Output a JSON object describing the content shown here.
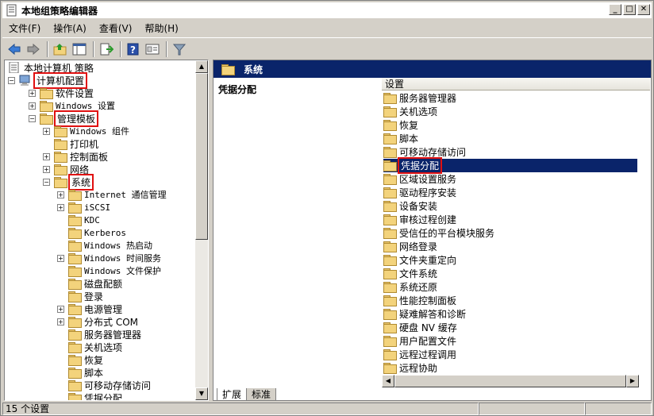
{
  "window": {
    "title": "本地组策略编辑器"
  },
  "caption_buttons": {
    "min": "_",
    "max": "□",
    "close": "✕"
  },
  "menu": [
    {
      "label": "文件(F)"
    },
    {
      "label": "操作(A)"
    },
    {
      "label": "查看(V)"
    },
    {
      "label": "帮助(H)"
    }
  ],
  "toolbar": {
    "icons": [
      "back-arrow-icon",
      "forward-arrow-icon",
      "up-folder-icon",
      "show-hide-tree-icon",
      "export-list-icon",
      "help-icon",
      "properties-icon",
      "filter-icon"
    ]
  },
  "tree": {
    "items": [
      {
        "label": "本地计算机 策略",
        "level": 0,
        "expander": "",
        "icon": "policy"
      },
      {
        "label": "计算机配置",
        "level": 0,
        "expander": "−",
        "icon": "computer"
      },
      {
        "label": "软件设置",
        "level": 1,
        "expander": "+",
        "icon": "folder"
      },
      {
        "label": "Windows 设置",
        "level": 1,
        "expander": "+",
        "icon": "folder"
      },
      {
        "label": "管理模板",
        "level": 1,
        "expander": "−",
        "icon": "folder"
      },
      {
        "label": "Windows 组件",
        "level": 2,
        "expander": "+",
        "icon": "folder"
      },
      {
        "label": "打印机",
        "level": 2,
        "expander": "",
        "icon": "folder"
      },
      {
        "label": "控制面板",
        "level": 2,
        "expander": "+",
        "icon": "folder"
      },
      {
        "label": "网络",
        "level": 2,
        "expander": "+",
        "icon": "folder"
      },
      {
        "label": "系统",
        "level": 2,
        "expander": "−",
        "icon": "folder"
      },
      {
        "label": "Internet 通信管理",
        "level": 3,
        "expander": "+",
        "icon": "folder"
      },
      {
        "label": "iSCSI",
        "level": 3,
        "expander": "+",
        "icon": "folder"
      },
      {
        "label": "KDC",
        "level": 3,
        "expander": "",
        "icon": "folder"
      },
      {
        "label": "Kerberos",
        "level": 3,
        "expander": "",
        "icon": "folder"
      },
      {
        "label": "Windows 热启动",
        "level": 3,
        "expander": "",
        "icon": "folder"
      },
      {
        "label": "Windows 时间服务",
        "level": 3,
        "expander": "+",
        "icon": "folder"
      },
      {
        "label": "Windows 文件保护",
        "level": 3,
        "expander": "",
        "icon": "folder"
      },
      {
        "label": "磁盘配额",
        "level": 3,
        "expander": "",
        "icon": "folder"
      },
      {
        "label": "登录",
        "level": 3,
        "expander": "",
        "icon": "folder"
      },
      {
        "label": "电源管理",
        "level": 3,
        "expander": "+",
        "icon": "folder"
      },
      {
        "label": "分布式 COM",
        "level": 3,
        "expander": "+",
        "icon": "folder"
      },
      {
        "label": "服务器管理器",
        "level": 3,
        "expander": "",
        "icon": "folder"
      },
      {
        "label": "关机选项",
        "level": 3,
        "expander": "",
        "icon": "folder"
      },
      {
        "label": "恢复",
        "level": 3,
        "expander": "",
        "icon": "folder"
      },
      {
        "label": "脚本",
        "level": 3,
        "expander": "",
        "icon": "folder"
      },
      {
        "label": "可移动存储访问",
        "level": 3,
        "expander": "",
        "icon": "folder"
      },
      {
        "label": "凭据分配",
        "level": 3,
        "expander": "",
        "icon": "folder"
      }
    ]
  },
  "right": {
    "header": "系统",
    "left_title": "凭据分配",
    "column_header": "设置",
    "items": [
      {
        "label": "服务器管理器"
      },
      {
        "label": "关机选项"
      },
      {
        "label": "恢复"
      },
      {
        "label": "脚本"
      },
      {
        "label": "可移动存储访问"
      },
      {
        "label": "凭据分配",
        "selected": true
      },
      {
        "label": "区域设置服务"
      },
      {
        "label": "驱动程序安装"
      },
      {
        "label": "设备安装"
      },
      {
        "label": "审核过程创建"
      },
      {
        "label": "受信任的平台模块服务"
      },
      {
        "label": "网络登录"
      },
      {
        "label": "文件夹重定向"
      },
      {
        "label": "文件系统"
      },
      {
        "label": "系统还原"
      },
      {
        "label": "性能控制面板"
      },
      {
        "label": "疑难解答和诊断"
      },
      {
        "label": "硬盘 NV 缓存"
      },
      {
        "label": "用户配置文件"
      },
      {
        "label": "远程过程调用"
      },
      {
        "label": "远程协助"
      }
    ],
    "tabs": [
      {
        "label": "扩展"
      },
      {
        "label": "标准"
      }
    ]
  },
  "status": {
    "text": "15 个设置"
  },
  "colors": {
    "selection": "#0a246a",
    "highlight_box": "#e01010",
    "window_bg": "#d4d0c8"
  }
}
